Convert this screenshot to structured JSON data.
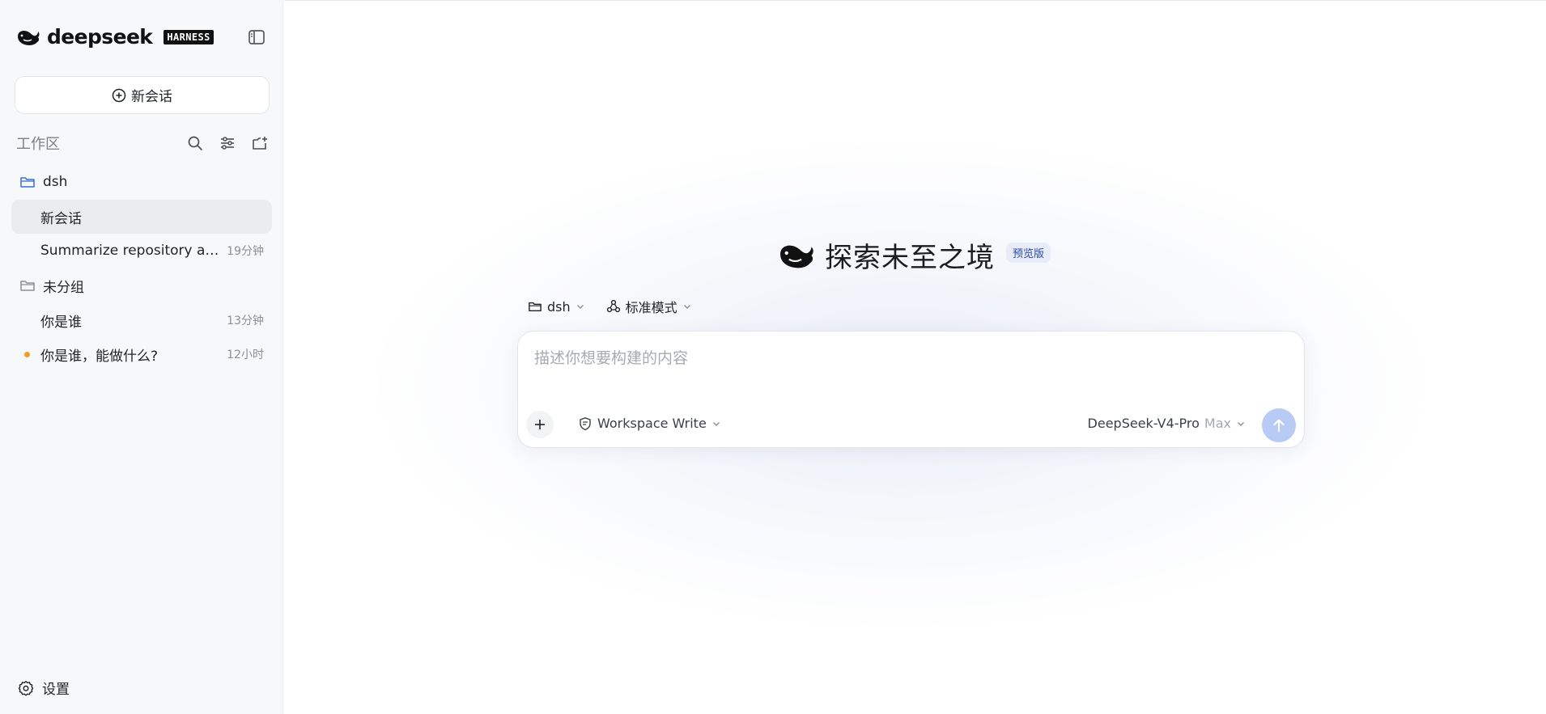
{
  "sidebar": {
    "brand": {
      "name": "deepseek",
      "badge": "HARNESS"
    },
    "new_chat_label": "新会话",
    "section_title": "工作区",
    "folders": [
      {
        "name": "dsh",
        "chats": [
          {
            "title": "新会话",
            "time": "",
            "active": true
          },
          {
            "title": "Summarize repository and ...",
            "time": "19分钟",
            "active": false
          }
        ]
      },
      {
        "name": "未分组",
        "chats": [
          {
            "title": "你是谁",
            "time": "13分钟",
            "active": false
          },
          {
            "title": "你是谁，能做什么?",
            "time": "12小时",
            "active": false,
            "unread": true
          }
        ]
      }
    ],
    "settings_label": "设置"
  },
  "main": {
    "title": "探索未至之境",
    "badge": "预览版",
    "workspace_selector": "dsh",
    "mode_selector": "标准模式",
    "composer": {
      "placeholder": "描述你想要构建的内容",
      "permission": "Workspace Write",
      "model": "DeepSeek-V4-Pro",
      "model_tier": "Max"
    }
  },
  "colors": {
    "accent": "#4d6bfe",
    "send_disabled": "#b8cbf4",
    "unread_dot": "#f59a23",
    "folder_active": "#3b6fd8"
  },
  "icons": [
    "whale-logo",
    "sidebar-toggle-icon",
    "plus-circle-icon",
    "search-icon",
    "filter-icon",
    "new-folder-icon",
    "folder-icon",
    "gear-icon",
    "chevron-down-icon",
    "shield-icon",
    "plus-icon",
    "arrow-up-icon"
  ]
}
